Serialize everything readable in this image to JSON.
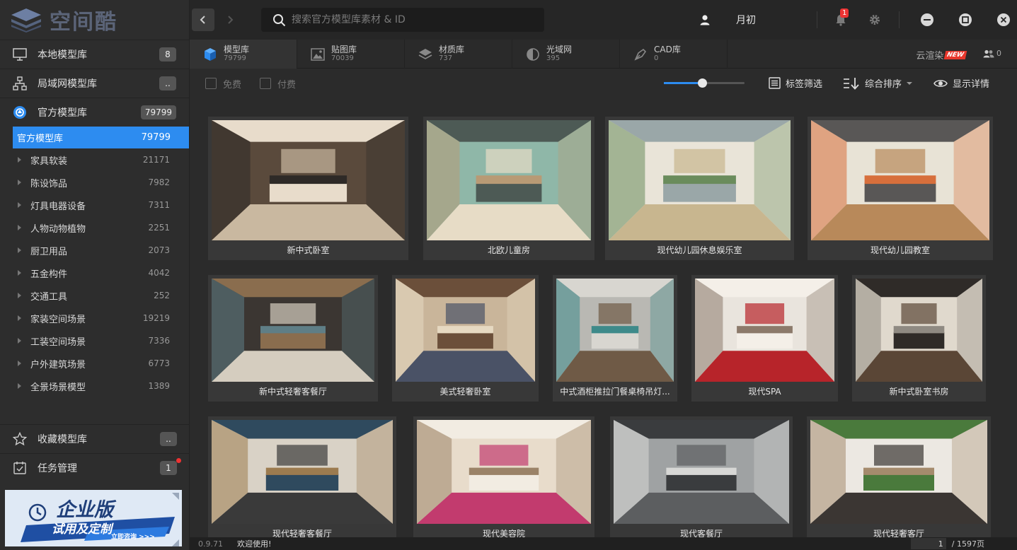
{
  "app": {
    "logo_text": "空间酷",
    "user_name": "月初",
    "notification_count": "1"
  },
  "search": {
    "placeholder": "搜索官方模型库素材 & ID"
  },
  "sidebar": {
    "libraries": [
      {
        "label": "本地模型库",
        "count": "8",
        "icon": "monitor-icon"
      },
      {
        "label": "局域网模型库",
        "count": "..",
        "icon": "network-icon"
      },
      {
        "label": "官方模型库",
        "count": "79799",
        "icon": "official-library-icon"
      }
    ],
    "active_node": {
      "label": "官方模型库",
      "count": "79799"
    },
    "categories": [
      {
        "label": "家具软装",
        "count": "21171"
      },
      {
        "label": "陈设饰品",
        "count": "7982"
      },
      {
        "label": "灯具电器设备",
        "count": "7311"
      },
      {
        "label": "人物动物植物",
        "count": "2251"
      },
      {
        "label": "厨卫用品",
        "count": "2073"
      },
      {
        "label": "五金构件",
        "count": "4042"
      },
      {
        "label": "交通工具",
        "count": "252"
      },
      {
        "label": "家装空间场景",
        "count": "19219"
      },
      {
        "label": "工装空间场景",
        "count": "7336"
      },
      {
        "label": "户外建筑场景",
        "count": "6773"
      },
      {
        "label": "全景场景模型",
        "count": "1389"
      }
    ],
    "favorites": {
      "label": "收藏模型库",
      "count": ".."
    },
    "tasks": {
      "label": "任务管理",
      "count": "1"
    },
    "ad": {
      "title": "企业版",
      "subtitle": "试用及定制",
      "cta": "立即咨询 >>>"
    }
  },
  "tabs": [
    {
      "name": "模型库",
      "count": "79799",
      "icon": "cube-icon"
    },
    {
      "name": "贴图库",
      "count": "70039",
      "icon": "image-icon"
    },
    {
      "name": "材质库",
      "count": "737",
      "icon": "layers-icon"
    },
    {
      "name": "光域网",
      "count": "395",
      "icon": "light-icon"
    },
    {
      "name": "CAD库",
      "count": "0",
      "icon": "cad-icon"
    }
  ],
  "cloud_render": {
    "label": "云渲染",
    "badge": "NEW"
  },
  "members": {
    "count": "0"
  },
  "filters": {
    "free_label": "免费",
    "paid_label": "付费",
    "zoom_level": 0.47,
    "tag_filter_label": "标签筛选",
    "sort_label": "综合排序",
    "details_label": "显示详情"
  },
  "items": [
    {
      "caption": "新中式卧室",
      "palette": [
        "#5a4a3c",
        "#c9b8a0",
        "#2e2a27",
        "#e8dccb"
      ]
    },
    {
      "caption": "北欧儿童房",
      "palette": [
        "#8fb7a8",
        "#e7dcc6",
        "#b89a75",
        "#4d5a55"
      ]
    },
    {
      "caption": "现代幼儿园休息娱乐室",
      "palette": [
        "#e9e4d8",
        "#c8b68f",
        "#6a8c5c",
        "#9aa7a8"
      ]
    },
    {
      "caption": "现代幼儿园教室",
      "palette": [
        "#e8e3d6",
        "#b8895a",
        "#d76f3c",
        "#595756"
      ]
    },
    {
      "caption": "新中式轻奢客餐厅",
      "palette": [
        "#3b3632",
        "#d5cdbf",
        "#5f7e86",
        "#8a6d4e"
      ]
    },
    {
      "caption": "美式轻奢卧室",
      "palette": [
        "#c9b59a",
        "#4a5266",
        "#e6d9c2",
        "#6b4f3a"
      ]
    },
    {
      "caption": "中式酒柜推拉门餐桌椅吊灯...",
      "palette": [
        "#b9b8b3",
        "#6f5a46",
        "#3e8a8a",
        "#d8d6d0"
      ]
    },
    {
      "caption": "现代SPA",
      "palette": [
        "#e9e4dd",
        "#b7242a",
        "#8c7a6b",
        "#f4efe8"
      ]
    },
    {
      "caption": "新中式卧室书房",
      "palette": [
        "#e0d9cd",
        "#5a4636",
        "#8f8a82",
        "#2f2b28"
      ]
    },
    {
      "caption": "现代轻奢客餐厅",
      "palette": [
        "#d9d2c6",
        "#3a3a3a",
        "#9c7b4f",
        "#2f4a5e"
      ]
    },
    {
      "caption": "现代美容院",
      "palette": [
        "#e8dccb",
        "#c23b6e",
        "#9b8368",
        "#f2ece2"
      ]
    },
    {
      "caption": "现代客餐厅",
      "palette": [
        "#9fa2a3",
        "#5c5e60",
        "#d7d7d5",
        "#3a3c3e"
      ]
    },
    {
      "caption": "现代轻奢客厅",
      "palette": [
        "#ece8e2",
        "#3b3633",
        "#a58b6d",
        "#4a7a3c"
      ]
    }
  ],
  "status": {
    "version": "0.9.71",
    "welcome": "欢迎使用!",
    "page": "1",
    "total_pages": "/ 1597页"
  }
}
